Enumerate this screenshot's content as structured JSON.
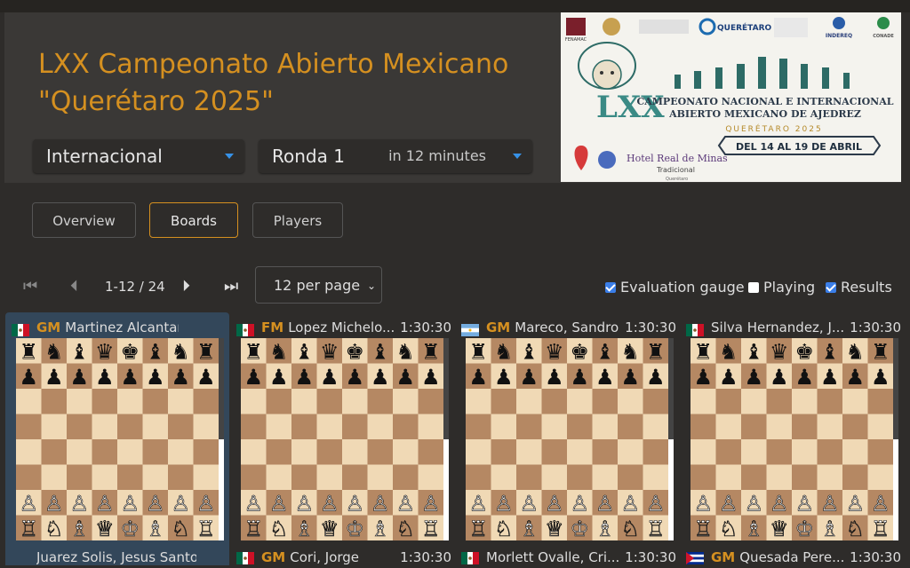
{
  "header": {
    "title_line1": "LXX Campeonato Abierto Mexicano",
    "title_line2": "\"Querétaro 2025\"",
    "category": "Internacional",
    "round": "Ronda 1",
    "round_hint": "in 12 minutes"
  },
  "banner": {
    "line1": "CAMPEONATO NACIONAL E INTERNACIONAL",
    "line2": "ABIERTO MEXICANO DE AJEDREZ",
    "city": "QUERÉTARO 2025",
    "dates": "DEL 14 AL 19 DE ABRIL",
    "lxx": "LXX",
    "hotel": "Hotel Real de Minas",
    "hotel_sub": "Tradicional",
    "hotel_city": "Querétaro",
    "sponsor_qro": "QUERÉTARO",
    "sponsor_indereq": "INDEREQ",
    "sponsor_conade": "CONADE",
    "sponsor_fenamac": "FENAMAC"
  },
  "tabs": {
    "overview": "Overview",
    "boards": "Boards",
    "players": "Players"
  },
  "pager": {
    "range": "1-12 / 24",
    "per_page": "12 per page",
    "evaluation_gauge": "Evaluation gauge",
    "playing": "Playing",
    "results": "Results"
  },
  "boards": [
    {
      "title": "GM",
      "name": "Martinez Alcantara, Jo...",
      "clock": "",
      "flag": "mexico"
    },
    {
      "title": "FM",
      "name": "Lopez Michelo...",
      "clock": "1:30:30",
      "flag": "mexico"
    },
    {
      "title": "GM",
      "name": "Mareco, Sandro",
      "clock": "1:30:30",
      "flag": "argentina"
    },
    {
      "title": "",
      "name": "Silva Hernandez, J...",
      "clock": "1:30:30",
      "flag": "mexico"
    }
  ],
  "bottom_players": [
    {
      "title": "",
      "name": "Juarez Solis, Jesus Santos",
      "clock": "",
      "flag": ""
    },
    {
      "title": "GM",
      "name": "Cori, Jorge",
      "clock": "1:30:30",
      "flag": "mexico"
    },
    {
      "title": "",
      "name": "Morlett Ovalle, Cri...",
      "clock": "1:30:30",
      "flag": "mexico"
    },
    {
      "title": "GM",
      "name": "Quesada Pere...",
      "clock": "1:30:30",
      "flag": "cuba"
    }
  ],
  "colors": {
    "accent": "#d59020",
    "light_square": "#f0d9b5",
    "dark_square": "#b58863",
    "check": "#3a7ee8"
  }
}
